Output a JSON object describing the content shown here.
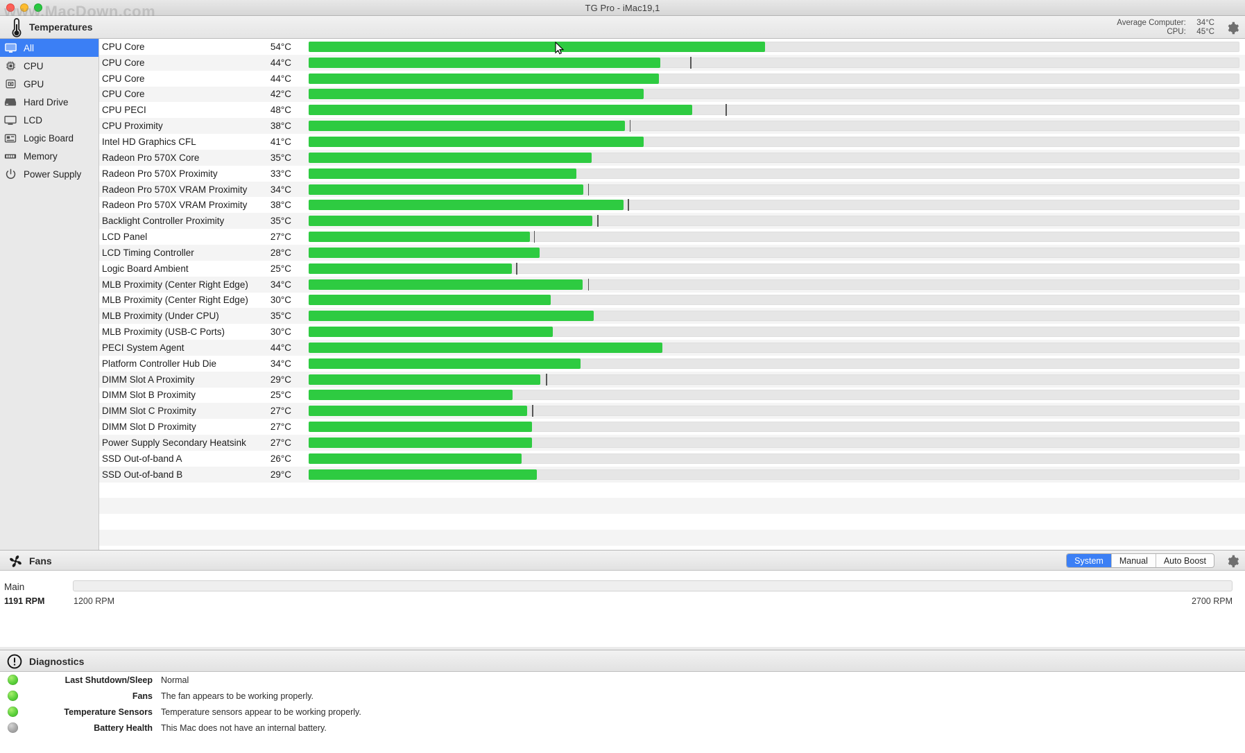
{
  "window": {
    "title": "TG Pro - iMac19,1",
    "watermark": "www.MacDown.com",
    "traffic_lights": [
      "close",
      "minimize",
      "zoom"
    ]
  },
  "temperatures_panel": {
    "icon": "thermometer-icon",
    "title": "Temperatures",
    "average_label": "Average Computer:",
    "average_value": "34°C",
    "cpu_label": "CPU:",
    "cpu_value": "45°C",
    "settings_icon": "gear-icon"
  },
  "sidebar": {
    "items": [
      {
        "label": "All",
        "icon": "display-icon",
        "active": true
      },
      {
        "label": "CPU",
        "icon": "cpu-chip-icon",
        "active": false
      },
      {
        "label": "GPU",
        "icon": "gpu-chip-icon",
        "active": false
      },
      {
        "label": "Hard Drive",
        "icon": "hard-drive-icon",
        "active": false
      },
      {
        "label": "LCD",
        "icon": "monitor-icon",
        "active": false
      },
      {
        "label": "Logic Board",
        "icon": "logic-board-icon",
        "active": false
      },
      {
        "label": "Memory",
        "icon": "memory-icon",
        "active": false
      },
      {
        "label": "Power Supply",
        "icon": "power-icon",
        "active": false
      }
    ]
  },
  "chart_data": {
    "type": "bar",
    "title": "Temperatures",
    "xlabel": "",
    "ylabel": "",
    "unit": "°C",
    "scale_max": 100,
    "bar_color": "#2ecb41",
    "track_color": "#e6e6e6",
    "peak_marker_color": "#565656",
    "categories": [
      "CPU Core",
      "CPU Core",
      "CPU Core",
      "CPU Core",
      "CPU PECI",
      "CPU Proximity",
      "Intel HD Graphics CFL",
      "Radeon Pro 570X Core",
      "Radeon Pro 570X Proximity",
      "Radeon Pro 570X VRAM Proximity",
      "Radeon Pro 570X VRAM Proximity",
      "Backlight Controller Proximity",
      "LCD Panel",
      "LCD Timing Controller",
      "Logic Board Ambient",
      "MLB Proximity (Center Right Edge)",
      "MLB Proximity (Center Right Edge)",
      "MLB Proximity (Under CPU)",
      "MLB Proximity (USB-C Ports)",
      "PECI System Agent",
      "Platform Controller Hub Die",
      "DIMM Slot A Proximity",
      "DIMM Slot B Proximity",
      "DIMM Slot C Proximity",
      "DIMM Slot D Proximity",
      "Power Supply Secondary Heatsink",
      "SSD Out-of-band A",
      "SSD Out-of-band B"
    ],
    "values": [
      54,
      44,
      44,
      42,
      48,
      38,
      41,
      35,
      33,
      34,
      38,
      35,
      27,
      28,
      25,
      34,
      30,
      35,
      30,
      44,
      34,
      29,
      25,
      27,
      27,
      27,
      26,
      29
    ],
    "peaks": [
      null,
      50,
      45,
      null,
      58,
      39,
      null,
      null,
      null,
      35,
      36,
      36,
      30,
      null,
      31,
      36,
      null,
      null,
      null,
      null,
      null,
      31,
      null,
      30,
      null,
      null,
      null,
      null
    ]
  },
  "temperature_rows": [
    {
      "name": "CPU Core",
      "value": "54°C",
      "pct": 49.0,
      "peak": null
    },
    {
      "name": "CPU Core",
      "value": "44°C",
      "pct": 37.8,
      "peak": 41.0
    },
    {
      "name": "CPU Core",
      "value": "44°C",
      "pct": 37.6,
      "peak": null
    },
    {
      "name": "CPU Core",
      "value": "42°C",
      "pct": 36.0,
      "peak": null
    },
    {
      "name": "CPU PECI",
      "value": "48°C",
      "pct": 41.2,
      "peak": 44.8
    },
    {
      "name": "CPU Proximity",
      "value": "38°C",
      "pct": 34.0,
      "peak": 34.5
    },
    {
      "name": "Intel HD Graphics CFL",
      "value": "41°C",
      "pct": 36.0,
      "peak": null
    },
    {
      "name": "Radeon Pro 570X Core",
      "value": "35°C",
      "pct": 30.4,
      "peak": null
    },
    {
      "name": "Radeon Pro 570X Proximity",
      "value": "33°C",
      "pct": 28.8,
      "peak": null
    },
    {
      "name": "Radeon Pro 570X VRAM Proximity",
      "value": "34°C",
      "pct": 29.5,
      "peak": 30.0
    },
    {
      "name": "Radeon Pro 570X VRAM Proximity",
      "value": "38°C",
      "pct": 33.8,
      "peak": 34.3
    },
    {
      "name": "Backlight Controller Proximity",
      "value": "35°C",
      "pct": 30.5,
      "peak": 31.0
    },
    {
      "name": "LCD Panel",
      "value": "27°C",
      "pct": 23.8,
      "peak": 24.2
    },
    {
      "name": "LCD Timing Controller",
      "value": "28°C",
      "pct": 24.8,
      "peak": null
    },
    {
      "name": "Logic Board Ambient",
      "value": "25°C",
      "pct": 21.8,
      "peak": 22.3
    },
    {
      "name": "MLB Proximity (Center Right Edge)",
      "value": "34°C",
      "pct": 29.4,
      "peak": 30.0
    },
    {
      "name": "MLB Proximity (Center Right Edge)",
      "value": "30°C",
      "pct": 26.0,
      "peak": null
    },
    {
      "name": "MLB Proximity (Under CPU)",
      "value": "35°C",
      "pct": 30.6,
      "peak": null
    },
    {
      "name": "MLB Proximity (USB-C Ports)",
      "value": "30°C",
      "pct": 26.2,
      "peak": null
    },
    {
      "name": "PECI System Agent",
      "value": "44°C",
      "pct": 38.0,
      "peak": null
    },
    {
      "name": "Platform Controller Hub Die",
      "value": "34°C",
      "pct": 29.2,
      "peak": null
    },
    {
      "name": "DIMM Slot A Proximity",
      "value": "29°C",
      "pct": 24.9,
      "peak": 25.5
    },
    {
      "name": "DIMM Slot B Proximity",
      "value": "25°C",
      "pct": 21.9,
      "peak": null
    },
    {
      "name": "DIMM Slot C Proximity",
      "value": "27°C",
      "pct": 23.5,
      "peak": 24.0
    },
    {
      "name": "DIMM Slot D Proximity",
      "value": "27°C",
      "pct": 24.0,
      "peak": null
    },
    {
      "name": "Power Supply Secondary Heatsink",
      "value": "27°C",
      "pct": 24.0,
      "peak": null
    },
    {
      "name": "SSD Out-of-band A",
      "value": "26°C",
      "pct": 22.9,
      "peak": null
    },
    {
      "name": "SSD Out-of-band B",
      "value": "29°C",
      "pct": 24.5,
      "peak": null
    }
  ],
  "fans_panel": {
    "icon": "fan-icon",
    "title": "Fans",
    "modes": [
      {
        "label": "System",
        "selected": true
      },
      {
        "label": "Manual",
        "selected": false
      },
      {
        "label": "Auto Boost",
        "selected": false
      }
    ],
    "settings_icon": "gear-icon",
    "fan": {
      "name": "Main",
      "current_rpm": "1191 RPM",
      "min_rpm": "1200 RPM",
      "max_rpm": "2700 RPM",
      "slider_value": 0
    }
  },
  "diagnostics_panel": {
    "icon": "exclamation-circle-icon",
    "title": "Diagnostics",
    "rows": [
      {
        "status": "green",
        "label": "Last Shutdown/Sleep",
        "text": "Normal"
      },
      {
        "status": "green",
        "label": "Fans",
        "text": "The fan appears to be working properly."
      },
      {
        "status": "green",
        "label": "Temperature Sensors",
        "text": "Temperature sensors appear to be working properly."
      },
      {
        "status": "grey",
        "label": "Battery Health",
        "text": "This Mac does not have an internal battery."
      }
    ]
  },
  "colors": {
    "accent": "#3b7ff5",
    "bar_green": "#2ecb41",
    "status_green": "#5ad03a",
    "status_grey": "#a6a6a6"
  }
}
